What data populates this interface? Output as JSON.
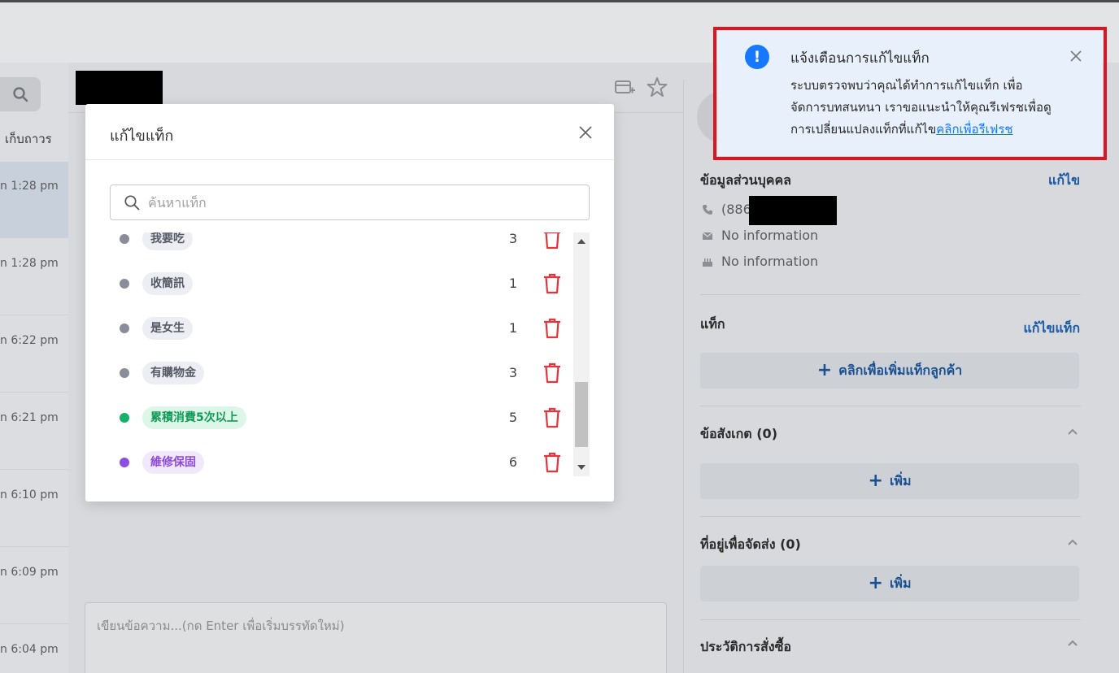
{
  "left_panel": {
    "filter_label": "เก็บถาวร",
    "conversations": [
      {
        "time": "n 1:28 pm",
        "selected": true
      },
      {
        "time": "n 1:28 pm"
      },
      {
        "time": "n 6:22 pm"
      },
      {
        "time": "n 6:21 pm"
      },
      {
        "time": "n 6:10 pm"
      },
      {
        "time": "n 6:09 pm"
      },
      {
        "time": "n 6:04 pm"
      }
    ]
  },
  "composer": {
    "placeholder": "เขียนข้อความ...(กด Enter เพื่อเริ่มบรรทัดใหม่)"
  },
  "profile": {
    "personal_info_title": "ข้อมูลส่วนบุคคล",
    "personal_info_edit": "แก้ไข",
    "phone_prefix": "(886",
    "email": "No information",
    "birthday": "No information",
    "tags_title": "แท็ก",
    "tags_edit": "แก้ไขแท็ก",
    "add_tag_label": "คลิกเพื่อเพิ่มแท็กลูกค้า",
    "notes_title": "ข้อสังเกต (0)",
    "notes_add": "เพิ่ม",
    "address_title": "ที่อยู่เพื่อจัดส่ง (0)",
    "address_add": "เพิ่ม",
    "orders_title": "ประวัติการสั่งซื้อ"
  },
  "modal": {
    "title": "แก้ไขแท็ก",
    "search_placeholder": "ค้นหาแท็ก",
    "tags": [
      {
        "name": "我要吃",
        "count": "3",
        "dot": "#8a8d99",
        "chip_bg": "#eceef3",
        "chip_fg": "#555a66"
      },
      {
        "name": "收簡訊",
        "count": "1",
        "dot": "#8a8d99",
        "chip_bg": "#eceef3",
        "chip_fg": "#555a66"
      },
      {
        "name": "是女生",
        "count": "1",
        "dot": "#8a8d99",
        "chip_bg": "#eceef3",
        "chip_fg": "#555a66"
      },
      {
        "name": "有購物金",
        "count": "3",
        "dot": "#8a8d99",
        "chip_bg": "#eceef3",
        "chip_fg": "#555a66"
      },
      {
        "name": "累積消費5次以上",
        "count": "5",
        "dot": "#16b06a",
        "chip_bg": "#dcf6e8",
        "chip_fg": "#129a58"
      },
      {
        "name": "維修保固",
        "count": "6",
        "dot": "#8e4fe0",
        "chip_bg": "#f1e8fc",
        "chip_fg": "#8c4bdc"
      }
    ],
    "delete_color": "#e8333c"
  },
  "notification": {
    "title": "แจ้งเตือนการแก้ไขแท็ก",
    "body_line1": "ระบบตรวจพบว่าคุณได้ทำการแก้ไขแท็ก เพื่อ",
    "body_line2": "จัดการบทสนทนา เราขอแนะนำให้คุณรีเฟรชเพื่อดู",
    "body_line3": "การเปลี่ยนแปลงแท็กที่แก้ไข",
    "refresh_link": "คลิกเพื่อรีเฟรช",
    "highlight_color": "#e0141e",
    "icon_color": "#1677ff"
  }
}
